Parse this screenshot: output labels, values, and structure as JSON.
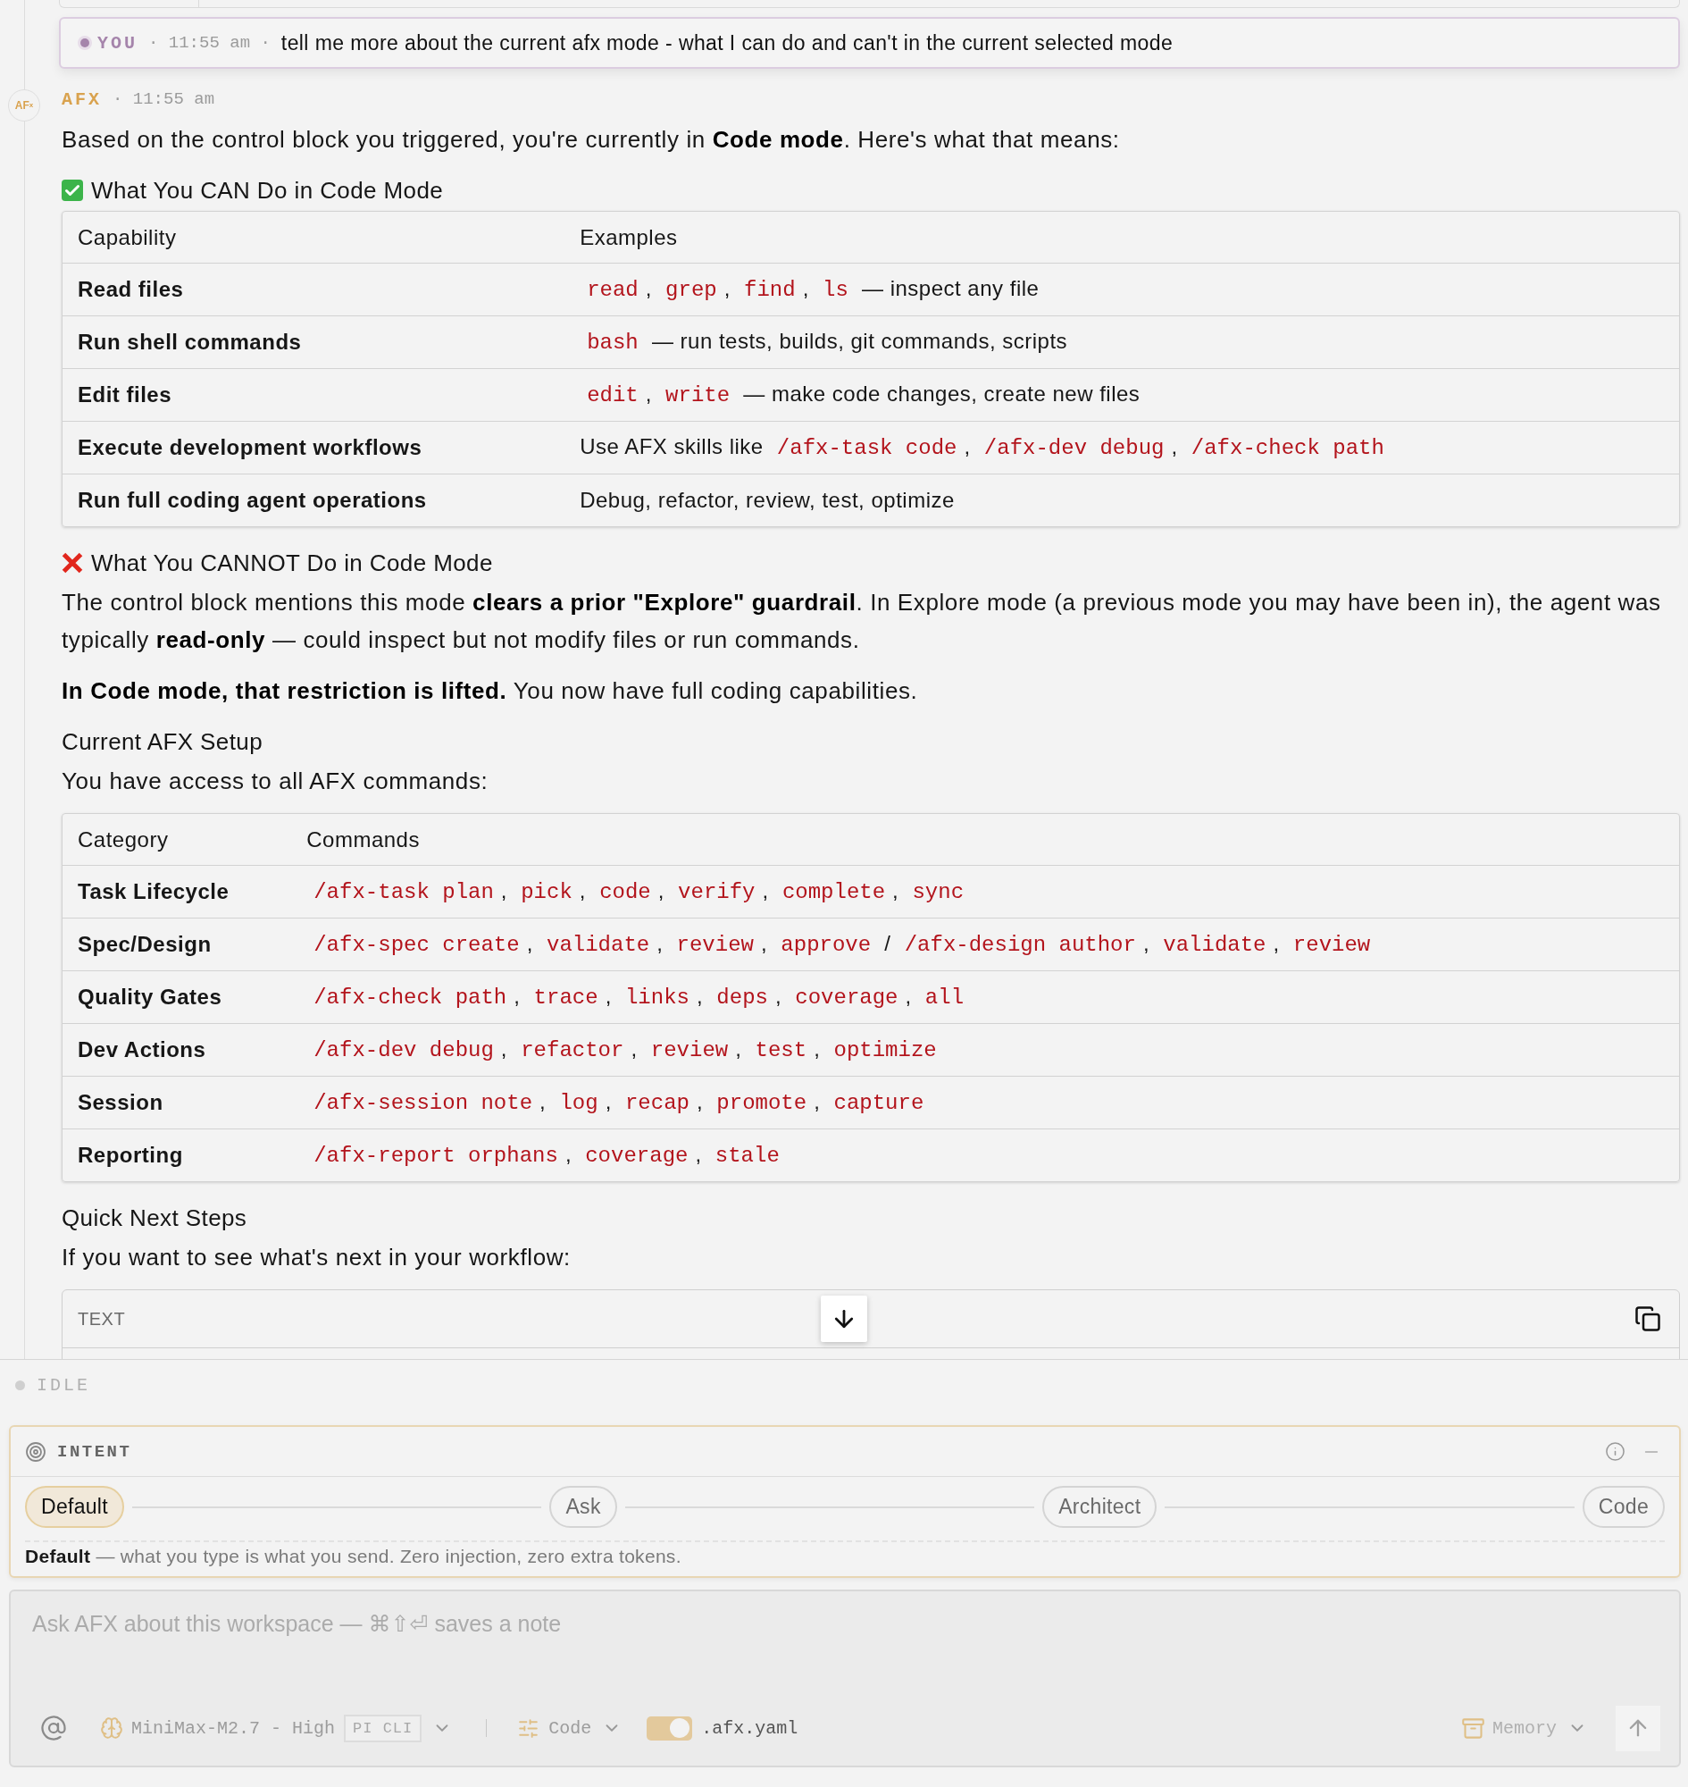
{
  "user_message": {
    "author": "YOU",
    "meta": "· 11:55 am ·",
    "text": "tell me more about the current afx mode - what I can do and can't in the current selected mode"
  },
  "assistant_message": {
    "avatar": "AF$^{x}$",
    "author": "AFX",
    "meta": "· 11:55 am",
    "blocks": [
      {
        "kind": "paragraph",
        "text": "Based on the control block you triggered, you're currently in **Code mode**. Here's what that means:"
      },
      {
        "kind": "check_heading",
        "text": "What You CAN Do in Code Mode"
      },
      {
        "kind": "table",
        "columns": [
          "Capability",
          "Examples"
        ],
        "rows": [
          {
            "label": "Read files",
            "content": [
              {
                "kind": "code",
                "text": "read"
              },
              {
                "kind": "text",
                "text": ", "
              },
              {
                "kind": "code",
                "text": "grep"
              },
              {
                "kind": "text",
                "text": ", "
              },
              {
                "kind": "code",
                "text": "find"
              },
              {
                "kind": "text",
                "text": ", "
              },
              {
                "kind": "code",
                "text": "ls"
              },
              {
                "kind": "text",
                "text": " — inspect any file"
              }
            ]
          },
          {
            "label": "Run shell commands",
            "content": [
              {
                "kind": "code",
                "text": "bash"
              },
              {
                "kind": "text",
                "text": " — run tests, builds, git commands, scripts"
              }
            ]
          },
          {
            "label": "Edit files",
            "content": [
              {
                "kind": "code",
                "text": "edit"
              },
              {
                "kind": "text",
                "text": ", "
              },
              {
                "kind": "code",
                "text": "write"
              },
              {
                "kind": "text",
                "text": " — make code changes, create new files"
              }
            ]
          },
          {
            "label": "Execute development workflows",
            "content": [
              {
                "kind": "text",
                "text": "Use AFX skills like "
              },
              {
                "kind": "code",
                "text": "/afx-task code"
              },
              {
                "kind": "text",
                "text": ", "
              },
              {
                "kind": "code",
                "text": "/afx-dev debug"
              },
              {
                "kind": "text",
                "text": ", "
              },
              {
                "kind": "code",
                "text": "/afx-check path"
              }
            ]
          },
          {
            "label": "Run full coding agent operations",
            "content": [
              {
                "kind": "text",
                "text": "Debug, refactor, review, test, optimize"
              }
            ]
          }
        ]
      },
      {
        "kind": "cross_heading",
        "text": "What You CANNOT Do in Code Mode"
      },
      {
        "kind": "paragraph",
        "text": "The control block mentions this mode **clears a prior \"Explore\" guardrail**. In Explore mode (a previous mode you may have been in), the agent was typically **read-only** — could inspect but not modify files or run commands."
      },
      {
        "kind": "paragraph",
        "text": "**In Code mode, that restriction is lifted.** You now have full coding capabilities."
      },
      {
        "kind": "heading",
        "text": "Current AFX Setup"
      },
      {
        "kind": "paragraph",
        "text": "You have access to all AFX commands:"
      },
      {
        "kind": "table",
        "columns": [
          "Category",
          "Commands"
        ],
        "rows": [
          {
            "label": "Task Lifecycle",
            "content": [
              {
                "kind": "code",
                "text": "/afx-task plan"
              },
              {
                "kind": "text",
                "text": ", "
              },
              {
                "kind": "code",
                "text": "pick"
              },
              {
                "kind": "text",
                "text": ", "
              },
              {
                "kind": "code",
                "text": "code"
              },
              {
                "kind": "text",
                "text": ", "
              },
              {
                "kind": "code",
                "text": "verify"
              },
              {
                "kind": "text",
                "text": ", "
              },
              {
                "kind": "code",
                "text": "complete"
              },
              {
                "kind": "text",
                "text": ", "
              },
              {
                "kind": "code",
                "text": "sync"
              }
            ]
          },
          {
            "label": "Spec/Design",
            "content": [
              {
                "kind": "code",
                "text": "/afx-spec create"
              },
              {
                "kind": "text",
                "text": ", "
              },
              {
                "kind": "code",
                "text": "validate"
              },
              {
                "kind": "text",
                "text": ", "
              },
              {
                "kind": "code",
                "text": "review"
              },
              {
                "kind": "text",
                "text": ", "
              },
              {
                "kind": "code",
                "text": "approve"
              },
              {
                "kind": "text",
                "text": " / "
              },
              {
                "kind": "code",
                "text": "/afx-design author"
              },
              {
                "kind": "text",
                "text": ", "
              },
              {
                "kind": "code",
                "text": "validate"
              },
              {
                "kind": "text",
                "text": ", "
              },
              {
                "kind": "code",
                "text": "review"
              }
            ]
          },
          {
            "label": "Quality Gates",
            "content": [
              {
                "kind": "code",
                "text": "/afx-check path"
              },
              {
                "kind": "text",
                "text": ", "
              },
              {
                "kind": "code",
                "text": "trace"
              },
              {
                "kind": "text",
                "text": ", "
              },
              {
                "kind": "code",
                "text": "links"
              },
              {
                "kind": "text",
                "text": ", "
              },
              {
                "kind": "code",
                "text": "deps"
              },
              {
                "kind": "text",
                "text": ", "
              },
              {
                "kind": "code",
                "text": "coverage"
              },
              {
                "kind": "text",
                "text": ", "
              },
              {
                "kind": "code",
                "text": "all"
              }
            ]
          },
          {
            "label": "Dev Actions",
            "content": [
              {
                "kind": "code",
                "text": "/afx-dev debug"
              },
              {
                "kind": "text",
                "text": ", "
              },
              {
                "kind": "code",
                "text": "refactor"
              },
              {
                "kind": "text",
                "text": ", "
              },
              {
                "kind": "code",
                "text": "review"
              },
              {
                "kind": "text",
                "text": ", "
              },
              {
                "kind": "code",
                "text": "test"
              },
              {
                "kind": "text",
                "text": ", "
              },
              {
                "kind": "code",
                "text": "optimize"
              }
            ]
          },
          {
            "label": "Session",
            "content": [
              {
                "kind": "code",
                "text": "/afx-session note"
              },
              {
                "kind": "text",
                "text": ", "
              },
              {
                "kind": "code",
                "text": "log"
              },
              {
                "kind": "text",
                "text": ", "
              },
              {
                "kind": "code",
                "text": "recap"
              },
              {
                "kind": "text",
                "text": ", "
              },
              {
                "kind": "code",
                "text": "promote"
              },
              {
                "kind": "text",
                "text": ", "
              },
              {
                "kind": "code",
                "text": "capture"
              }
            ]
          },
          {
            "label": "Reporting",
            "content": [
              {
                "kind": "code",
                "text": "/afx-report orphans"
              },
              {
                "kind": "text",
                "text": ", "
              },
              {
                "kind": "code",
                "text": "coverage"
              },
              {
                "kind": "text",
                "text": ", "
              },
              {
                "kind": "code",
                "text": "stale"
              }
            ]
          }
        ]
      },
      {
        "kind": "heading",
        "text": "Quick Next Steps"
      },
      {
        "kind": "paragraph",
        "text": "If you want to see what's next in your workflow:"
      },
      {
        "kind": "code_block",
        "language": "TEXT"
      }
    ]
  },
  "status": {
    "label": "IDLE"
  },
  "intent": {
    "title": "INTENT",
    "modes": [
      {
        "label": "Default",
        "selected": true
      },
      {
        "label": "Ask",
        "selected": false
      },
      {
        "label": "Architect",
        "selected": false
      },
      {
        "label": "Code",
        "selected": false
      }
    ],
    "description": "**Default** — what you type is what you send. Zero injection, zero extra tokens."
  },
  "composer": {
    "placeholder": "Ask AFX about this workspace — ⌘⇧⏎ saves a note",
    "model": "MiniMax-M2.7 - High",
    "model_badge": "PI CLI",
    "mode": "Code",
    "config_toggle": {
      "on": true,
      "label": ".afx.yaml"
    },
    "memory": "Memory"
  }
}
